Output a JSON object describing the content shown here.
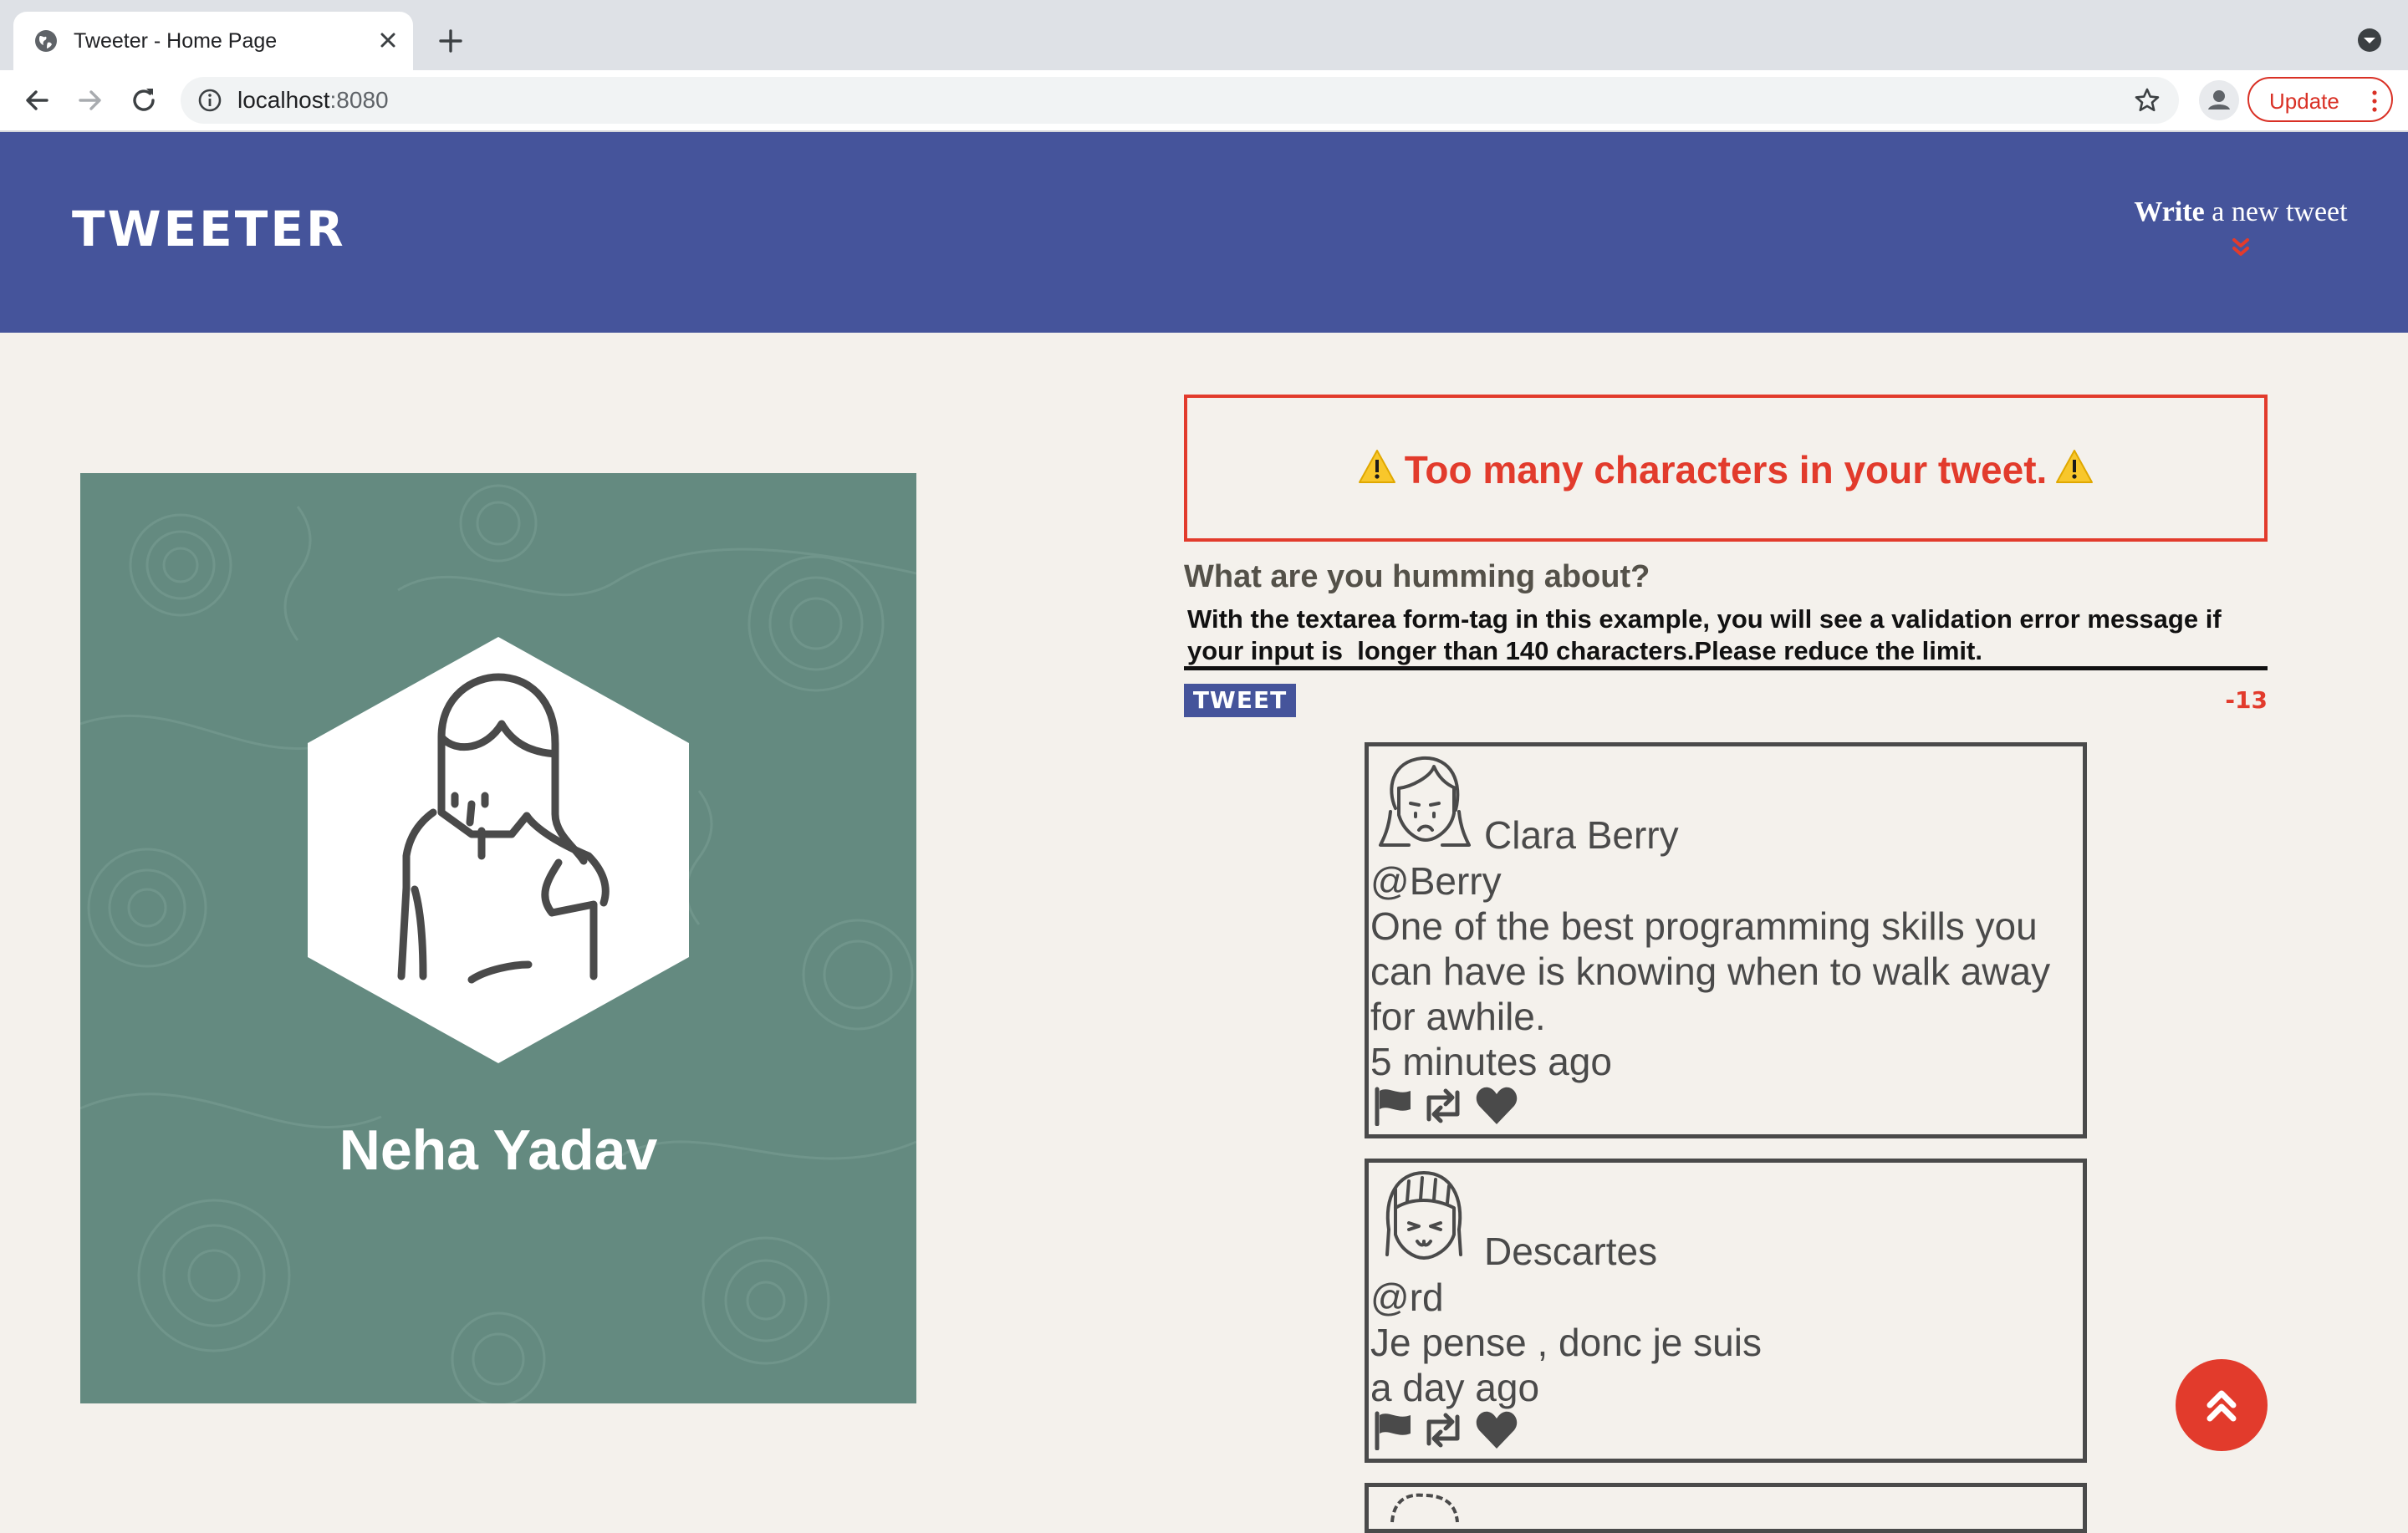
{
  "browser": {
    "tab_title": "Tweeter - Home Page",
    "url_host": "localhost",
    "url_port": ":8080",
    "update_label": "Update"
  },
  "header": {
    "logo": "TWEETER",
    "compose_bold": "Write",
    "compose_rest": " a new tweet",
    "bg_color": "#45549b",
    "accent_color": "#e23b2c"
  },
  "profile": {
    "name": "Neha Yadav",
    "card_color": "#648a80"
  },
  "compose": {
    "error_message": "Too many characters in your tweet.",
    "question": "What are you humming about?",
    "text": "With the textarea form-tag in this example, you will see a validation error message if your input is  longer than 140 characters.Please reduce the limit.",
    "submit_label": "TWEET",
    "counter": "-13"
  },
  "tweets": [
    {
      "name": "Clara Berry",
      "handle": "@Berry",
      "content": "One of the best programming skills you can have is knowing when to walk away for awhile.",
      "time": "5 minutes ago",
      "avatar": "sad-face-girl-avatar"
    },
    {
      "name": "Descartes",
      "handle": "@rd",
      "content": "Je pense , donc je suis",
      "time": "a day ago",
      "avatar": "happy-face-girl-avatar"
    }
  ],
  "icons": {
    "flag": "flag-icon",
    "retweet": "retweet-icon",
    "like": "heart-icon",
    "scroll_top": "double-chevron-up-icon"
  }
}
